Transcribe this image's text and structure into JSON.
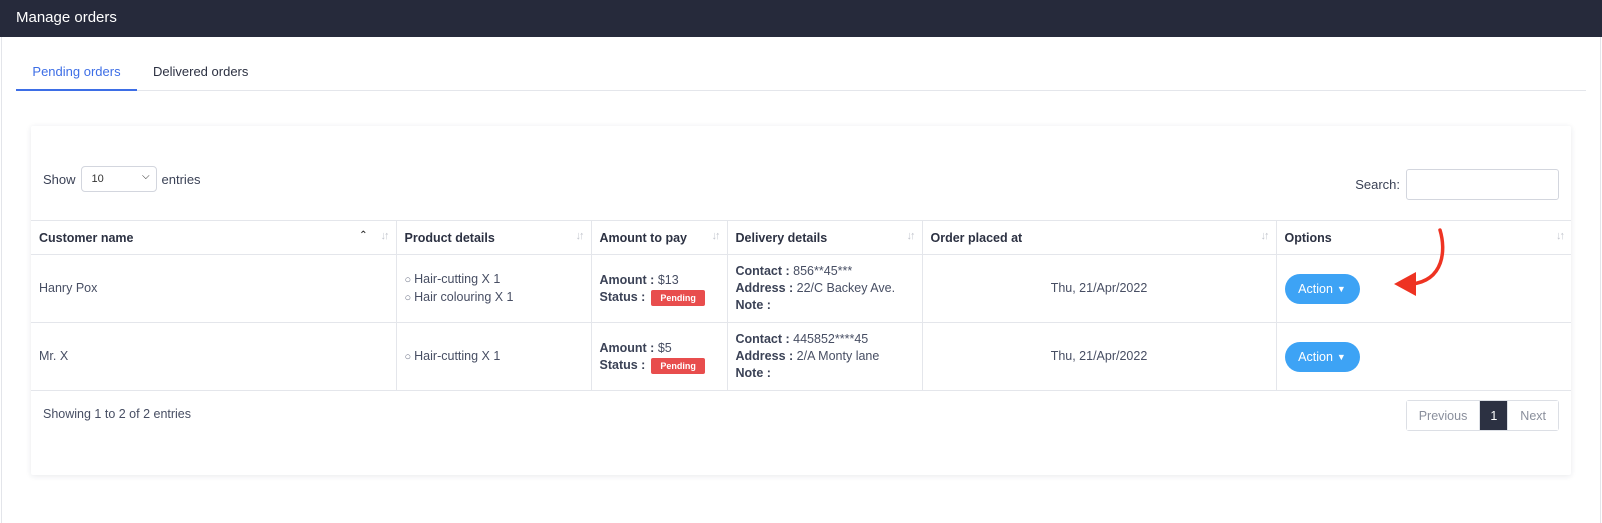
{
  "header": {
    "title": "Manage orders"
  },
  "tabs": [
    {
      "label": "Pending orders",
      "active": true
    },
    {
      "label": "Delivered orders",
      "active": false
    }
  ],
  "table_controls": {
    "show_label": "Show",
    "entries_value": "10",
    "entries_label": "entries",
    "search_label": "Search:",
    "search_value": ""
  },
  "columns": [
    "Customer name",
    "Product details",
    "Amount to pay",
    "Delivery details",
    "Order placed at",
    "Options"
  ],
  "orders": [
    {
      "customer": "Hanry Pox",
      "products": [
        "Hair-cutting X 1",
        "Hair colouring X 1"
      ],
      "amount_label": "Amount :",
      "amount": "$13",
      "status_label": "Status :",
      "status": "Pending",
      "contact_label": "Contact :",
      "contact": "856**45***",
      "address_label": "Address :",
      "address": "22/C Backey Ave.",
      "note_label": "Note :",
      "note": "",
      "placed_at": "Thu, 21/Apr/2022",
      "action_label": "Action"
    },
    {
      "customer": "Mr. X",
      "products": [
        "Hair-cutting X 1"
      ],
      "amount_label": "Amount :",
      "amount": "$5",
      "status_label": "Status :",
      "status": "Pending",
      "contact_label": "Contact :",
      "contact": "445852****45",
      "address_label": "Address :",
      "address": "2/A Monty lane",
      "note_label": "Note :",
      "note": "",
      "placed_at": "Thu, 21/Apr/2022",
      "action_label": "Action"
    }
  ],
  "footer": {
    "info": "Showing 1 to 2 of 2 entries",
    "previous": "Previous",
    "page": "1",
    "next": "Next"
  },
  "colors": {
    "topbar": "#262a3b",
    "accent": "#3d6ee6",
    "action_button": "#3da3f5",
    "pending_badge": "#e84d4d",
    "annotation_arrow": "#ee3322"
  },
  "icons": {
    "sort": "sort-arrows-icon",
    "sort_asc": "chevron-up-icon",
    "caret": "caret-down-icon",
    "bullet": "circle-bullet-icon",
    "annotation": "red-arrow-icon"
  }
}
